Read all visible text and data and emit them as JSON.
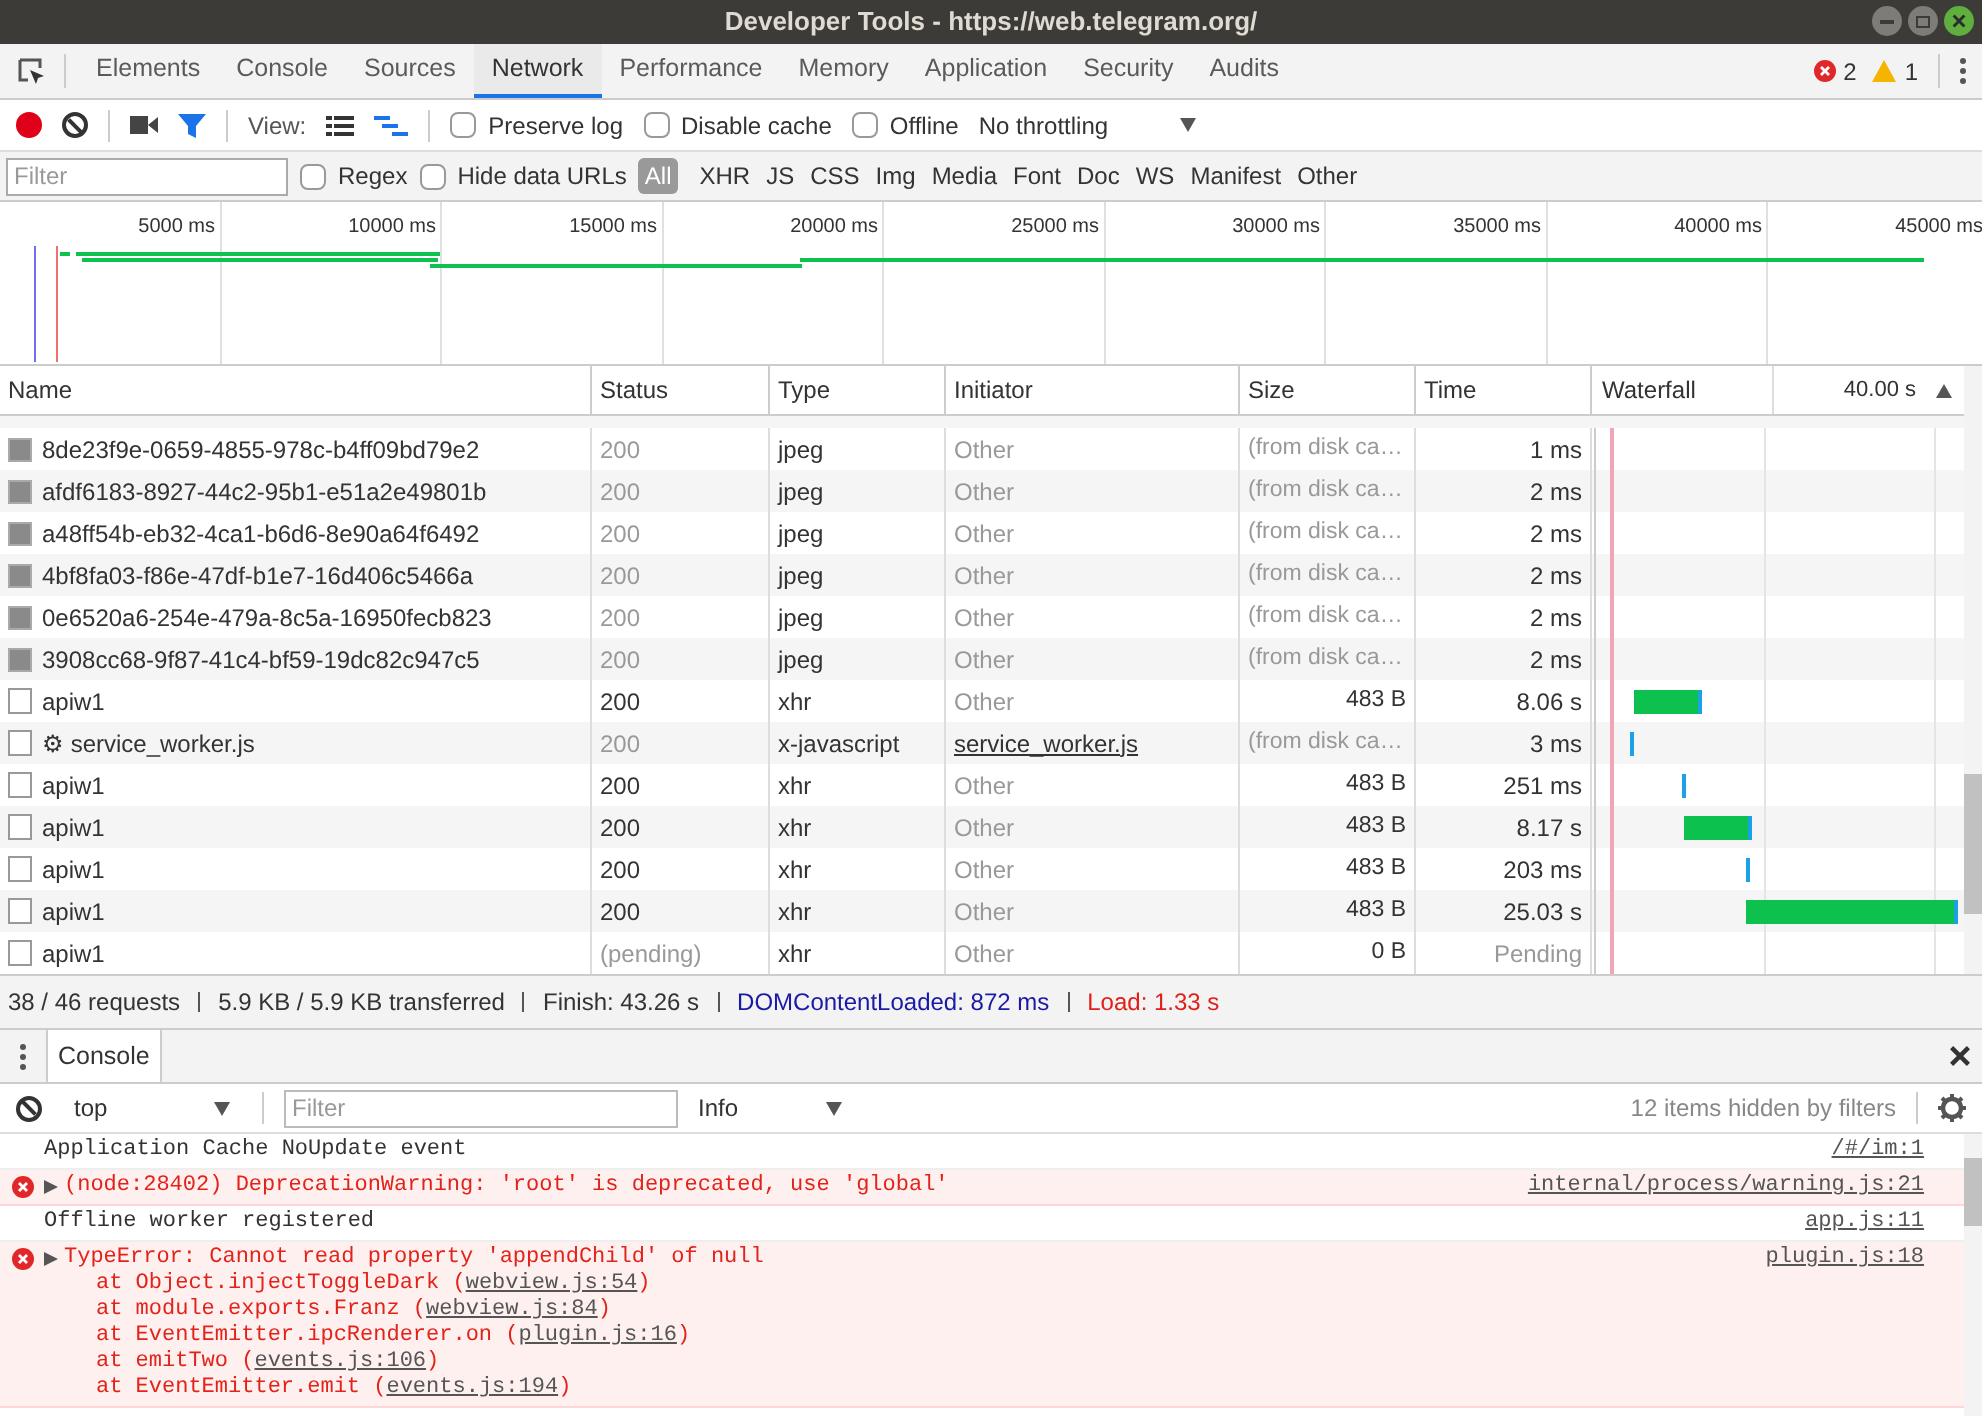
{
  "window": {
    "title": "Developer Tools - https://web.telegram.org/"
  },
  "tabs": [
    {
      "label": "Elements",
      "selected": false
    },
    {
      "label": "Console",
      "selected": false
    },
    {
      "label": "Sources",
      "selected": false
    },
    {
      "label": "Network",
      "selected": true
    },
    {
      "label": "Performance",
      "selected": false
    },
    {
      "label": "Memory",
      "selected": false
    },
    {
      "label": "Application",
      "selected": false
    },
    {
      "label": "Security",
      "selected": false
    },
    {
      "label": "Audits",
      "selected": false
    }
  ],
  "counters": {
    "errors": "2",
    "warnings": "1"
  },
  "toolbar": {
    "recording": true,
    "view_label": "View:",
    "checkboxes": [
      {
        "label": "Preserve log",
        "checked": false
      },
      {
        "label": "Disable cache",
        "checked": false
      },
      {
        "label": "Offline",
        "checked": false
      }
    ],
    "throttling": "No throttling"
  },
  "filter_bar": {
    "placeholder": "Filter",
    "checkboxes": [
      {
        "label": "Regex",
        "checked": false
      },
      {
        "label": "Hide data URLs",
        "checked": false
      }
    ],
    "types": [
      {
        "label": "All",
        "selected": true
      },
      {
        "label": "XHR",
        "selected": false
      },
      {
        "label": "JS",
        "selected": false
      },
      {
        "label": "CSS",
        "selected": false
      },
      {
        "label": "Img",
        "selected": false
      },
      {
        "label": "Media",
        "selected": false
      },
      {
        "label": "Font",
        "selected": false
      },
      {
        "label": "Doc",
        "selected": false
      },
      {
        "label": "WS",
        "selected": false
      },
      {
        "label": "Manifest",
        "selected": false
      },
      {
        "label": "Other",
        "selected": false
      }
    ]
  },
  "overview": {
    "ticks": [
      "5000 ms",
      "10000 ms",
      "15000 ms",
      "20000 ms",
      "25000 ms",
      "30000 ms",
      "35000 ms",
      "40000 ms",
      "45000 ms"
    ]
  },
  "table": {
    "columns": [
      "Name",
      "Status",
      "Type",
      "Initiator",
      "Size",
      "Time",
      "Waterfall"
    ],
    "waterfall_scale": "40.00 s",
    "rows": [
      {
        "kind": "image",
        "name": "8de23f9e-0659-4855-978c-b4ff09bd79e2",
        "status": "200",
        "status_dimmed": true,
        "type": "jpeg",
        "initiator": "Other",
        "initiator_link": false,
        "size": "(from disk ca…",
        "time": "1 ms",
        "time_dimmed": false
      },
      {
        "kind": "image",
        "name": "afdf6183-8927-44c2-95b1-e51a2e49801b",
        "status": "200",
        "status_dimmed": true,
        "type": "jpeg",
        "initiator": "Other",
        "initiator_link": false,
        "size": "(from disk ca…",
        "time": "2 ms",
        "time_dimmed": false
      },
      {
        "kind": "image",
        "name": "a48ff54b-eb32-4ca1-b6d6-8e90a64f6492",
        "status": "200",
        "status_dimmed": true,
        "type": "jpeg",
        "initiator": "Other",
        "initiator_link": false,
        "size": "(from disk ca…",
        "time": "2 ms",
        "time_dimmed": false
      },
      {
        "kind": "image",
        "name": "4bf8fa03-f86e-47df-b1e7-16d406c5466a",
        "status": "200",
        "status_dimmed": true,
        "type": "jpeg",
        "initiator": "Other",
        "initiator_link": false,
        "size": "(from disk ca…",
        "time": "2 ms",
        "time_dimmed": false
      },
      {
        "kind": "image",
        "name": "0e6520a6-254e-479a-8c5a-16950fecb823",
        "status": "200",
        "status_dimmed": true,
        "type": "jpeg",
        "initiator": "Other",
        "initiator_link": false,
        "size": "(from disk ca…",
        "time": "2 ms",
        "time_dimmed": false
      },
      {
        "kind": "image",
        "name": "3908cc68-9f87-41c4-bf59-19dc82c947c5",
        "status": "200",
        "status_dimmed": true,
        "type": "jpeg",
        "initiator": "Other",
        "initiator_link": false,
        "size": "(from disk ca…",
        "time": "2 ms",
        "time_dimmed": false
      },
      {
        "kind": "document",
        "name": "apiw1",
        "status": "200",
        "status_dimmed": false,
        "type": "xhr",
        "initiator": "Other",
        "initiator_link": false,
        "size": "483 B",
        "time": "8.06 s",
        "time_dimmed": false
      },
      {
        "kind": "document",
        "name": "⚙ service_worker.js",
        "status": "200",
        "status_dimmed": true,
        "type": "x-javascript",
        "initiator": "service_worker.js",
        "initiator_link": true,
        "size": "(from disk ca…",
        "time": "3 ms",
        "time_dimmed": false
      },
      {
        "kind": "document",
        "name": "apiw1",
        "status": "200",
        "status_dimmed": false,
        "type": "xhr",
        "initiator": "Other",
        "initiator_link": false,
        "size": "483 B",
        "time": "251 ms",
        "time_dimmed": false
      },
      {
        "kind": "document",
        "name": "apiw1",
        "status": "200",
        "status_dimmed": false,
        "type": "xhr",
        "initiator": "Other",
        "initiator_link": false,
        "size": "483 B",
        "time": "8.17 s",
        "time_dimmed": false
      },
      {
        "kind": "document",
        "name": "apiw1",
        "status": "200",
        "status_dimmed": false,
        "type": "xhr",
        "initiator": "Other",
        "initiator_link": false,
        "size": "483 B",
        "time": "203 ms",
        "time_dimmed": false
      },
      {
        "kind": "document",
        "name": "apiw1",
        "status": "200",
        "status_dimmed": false,
        "type": "xhr",
        "initiator": "Other",
        "initiator_link": false,
        "size": "483 B",
        "time": "25.03 s",
        "time_dimmed": false
      },
      {
        "kind": "document",
        "name": "apiw1",
        "status": "(pending)",
        "status_dimmed": true,
        "type": "xhr",
        "initiator": "Other",
        "initiator_link": false,
        "size": "0 B",
        "time": "Pending",
        "time_dimmed": true
      }
    ]
  },
  "summary": [
    {
      "text": "38 / 46 requests",
      "color": "#333333"
    },
    {
      "text": "5.9 KB / 5.9 KB transferred",
      "color": "#333333"
    },
    {
      "text": "Finish: 43.26 s",
      "color": "#333333"
    },
    {
      "text": "DOMContentLoaded: 872 ms",
      "color": "#1a1aa6"
    },
    {
      "text": "Load: 1.33 s",
      "color": "#e0201a"
    }
  ],
  "drawer": {
    "tab": "Console",
    "context": "top",
    "filter_placeholder": "Filter",
    "level": "Info",
    "hidden_note": "12 items hidden by filters",
    "messages": [
      {
        "kind": "log",
        "text": "Application Cache NoUpdate event",
        "source": "/#/im:1"
      },
      {
        "kind": "error",
        "text": "(node:28402) DeprecationWarning: 'root' is deprecated, use 'global'",
        "source": "internal/process/warning.js:21"
      },
      {
        "kind": "log",
        "text": "Offline worker registered",
        "source": "app.js:11"
      },
      {
        "kind": "error",
        "text": "TypeError: Cannot read property 'appendChild' of null",
        "source": "plugin.js:18",
        "stack": [
          {
            "before": "at Object.injectToggleDark (",
            "link": "webview.js:54",
            "after": ")"
          },
          {
            "before": "at module.exports.Franz (",
            "link": "webview.js:84",
            "after": ")"
          },
          {
            "before": "at EventEmitter.ipcRenderer.on (",
            "link": "plugin.js:16",
            "after": ")"
          },
          {
            "before": "at emitTwo (",
            "link": "events.js:106",
            "after": ")"
          },
          {
            "before": "at EventEmitter.emit (",
            "link": "events.js:194",
            "after": ")"
          }
        ]
      }
    ]
  }
}
